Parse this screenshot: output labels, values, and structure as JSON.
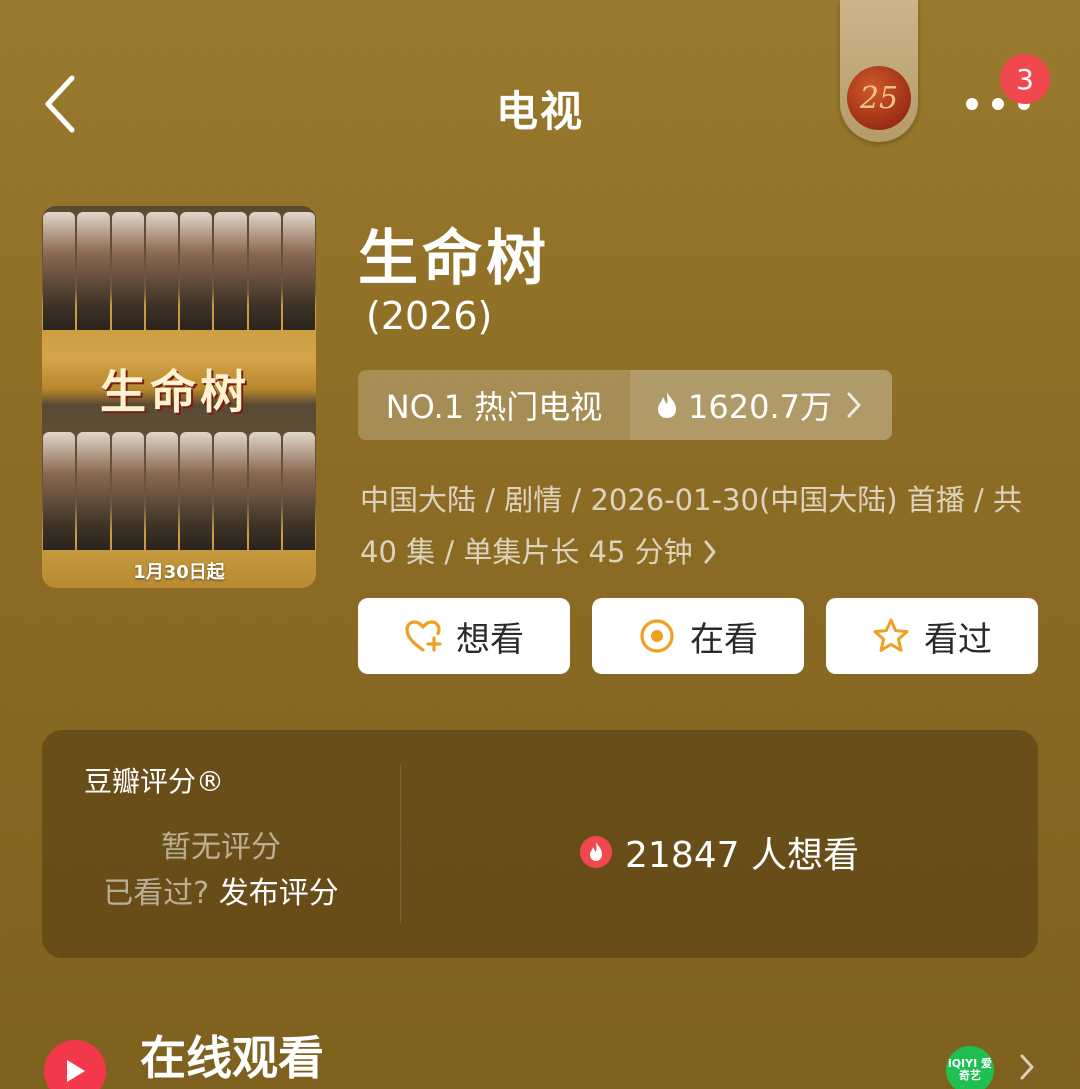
{
  "header": {
    "title": "电视",
    "year_badge": "25",
    "notification_count": "3"
  },
  "poster": {
    "title_art": "生命树",
    "date_text": "1月30日起"
  },
  "show": {
    "title": "生命树",
    "year": "(2026)",
    "rank_label": "NO.1 热门电视",
    "heat_value": "1620.7万",
    "meta_line1": "中国大陆 / 剧情 / 2026-01-30(中国大陆) 首播 / 共",
    "meta_line2": "40 集 / 单集片长 45 分钟"
  },
  "actions": {
    "want_label": "想看",
    "watching_label": "在看",
    "watched_label": "看过"
  },
  "rating": {
    "brand": "豆瓣评分®",
    "no_rating": "暂无评分",
    "watched_prompt": "已看过?",
    "publish_label": "发布评分",
    "want_count_text": "21847 人想看"
  },
  "online": {
    "title": "在线观看",
    "provider_logo_text": "iQIYI 爱奇艺"
  },
  "colors": {
    "background": "#8d6d25",
    "accent_orange": "#f0a020",
    "badge_red": "#f0484e",
    "play_red": "#f2384a",
    "iqiyi_green": "#1fbf52"
  },
  "icons": {
    "back": "chevron-left-icon",
    "more": "more-dots-icon",
    "heat": "flame-icon",
    "want": "heart-plus-icon",
    "watching": "target-circle-icon",
    "watched": "star-icon",
    "want_count": "fire-badge-icon",
    "online": "play-circle-icon"
  }
}
